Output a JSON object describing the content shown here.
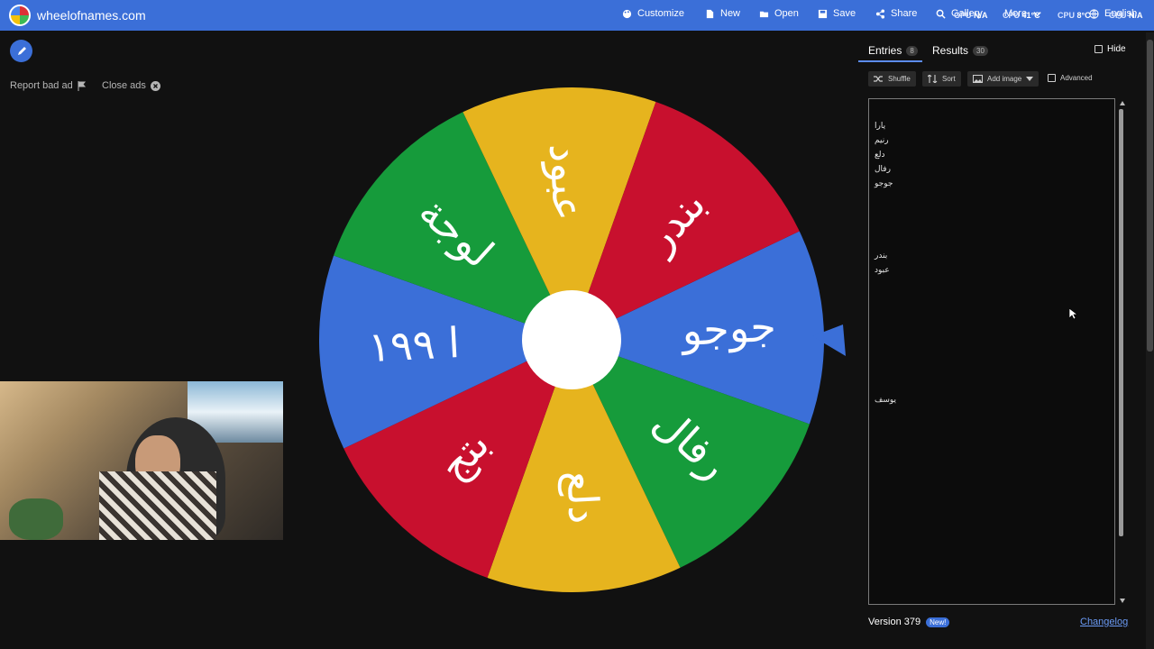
{
  "app": {
    "site_title": "wheelofnames.com",
    "menu": [
      {
        "label": "Customize",
        "icon": "palette-icon"
      },
      {
        "label": "New",
        "icon": "new-file-icon"
      },
      {
        "label": "Open",
        "icon": "folder-open-icon"
      },
      {
        "label": "Save",
        "icon": "save-icon"
      },
      {
        "label": "Share",
        "icon": "share-icon"
      },
      {
        "label": "Gallery",
        "icon": "search-icon"
      },
      {
        "label": "More",
        "icon": "chevron-down-icon"
      },
      {
        "label": "English",
        "icon": "globe-icon"
      }
    ],
    "brand_color": "#3b6fd8"
  },
  "overlay": {
    "gpu_label": "GPU",
    "gpu_value": "N/A",
    "cpu1_label": "CPU",
    "cpu1_value": "41°C",
    "cpu2_label": "CPU",
    "cpu2_value": "8°C",
    "gpu2_label": "GPU",
    "gpu2_value": "N/A"
  },
  "ads": {
    "report_label": "Report bad ad",
    "close_label": "Close ads"
  },
  "wheel": {
    "colors": {
      "red": "#c8102e",
      "blue": "#3b6fd8",
      "green": "#169b3b",
      "yellow": "#e6b41e"
    },
    "slices": [
      {
        "label": "جوجو",
        "color": "blue"
      },
      {
        "label": "رفال",
        "color": "green"
      },
      {
        "label": "دلع",
        "color": "yellow"
      },
      {
        "label": "بتج",
        "color": "red"
      },
      {
        "label": "ا ١٩٩",
        "color": "blue"
      },
      {
        "label": "لوجة",
        "color": "green"
      },
      {
        "label": "عبود",
        "color": "yellow"
      },
      {
        "label": "بندر",
        "color": "red"
      }
    ]
  },
  "panel": {
    "tabs": [
      {
        "label": "Entries",
        "count": "8"
      },
      {
        "label": "Results",
        "count": "30"
      }
    ],
    "hide_label": "Hide",
    "toolbar": {
      "shuffle": "Shuffle",
      "sort": "Sort",
      "add_image": "Add image",
      "advanced": "Advanced"
    },
    "entries": [
      "يارا",
      "رنيم",
      "دلع",
      "رفال",
      "جوجو",
      "",
      "",
      "",
      "",
      "بندر",
      "عبود",
      "",
      "",
      "",
      "",
      "",
      "",
      "",
      "",
      "يوسف"
    ],
    "version": "Version 379",
    "new_badge": "New!",
    "changelog": "Changelog"
  }
}
